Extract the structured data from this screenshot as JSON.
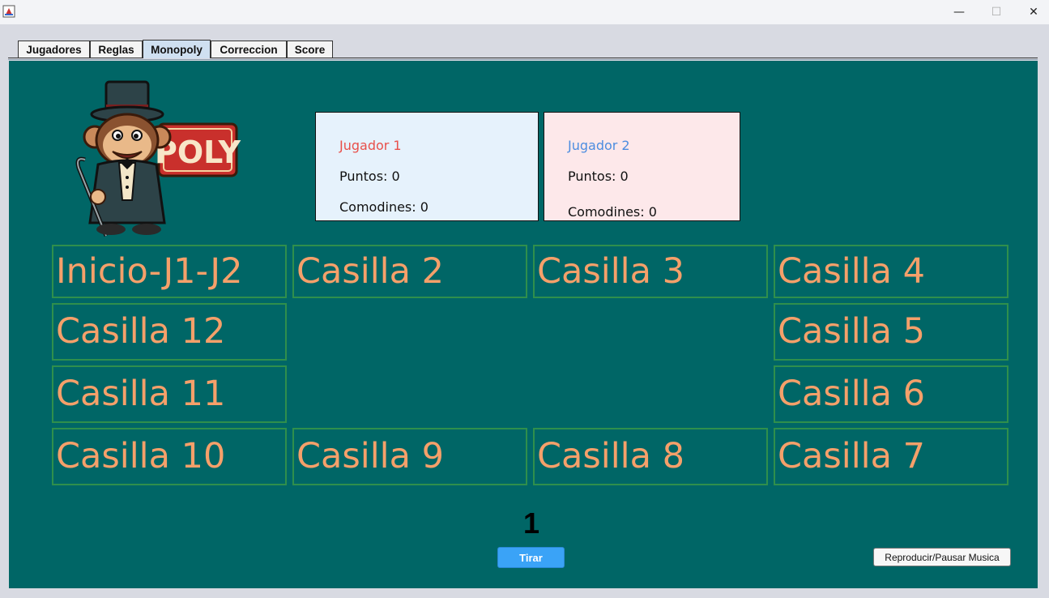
{
  "window": {
    "minimize_glyph": "—",
    "maximize_glyph": "☐",
    "close_glyph": "✕"
  },
  "tabs": [
    {
      "label": "Jugadores"
    },
    {
      "label": "Reglas"
    },
    {
      "label": "Monopoly",
      "active": true
    },
    {
      "label": "Correccion"
    },
    {
      "label": "Score"
    }
  ],
  "logo": {
    "text": "POLY"
  },
  "players": [
    {
      "name": "Jugador 1",
      "puntos": "Puntos: 0",
      "comodines": "Comodines: 0",
      "name_color": "#e8504a",
      "bg": "#e6f2fc"
    },
    {
      "name": "Jugador 2",
      "puntos": "Puntos: 0",
      "comodines": "Comodines: 0",
      "name_color": "#4d8de0",
      "bg": "#fde8ea"
    }
  ],
  "board": {
    "cells": [
      "Inicio-J1-J2",
      "Casilla 2",
      "Casilla 3",
      "Casilla 4",
      "Casilla 5",
      "Casilla 6",
      "Casilla 7",
      "Casilla 8",
      "Casilla 9",
      "Casilla 10",
      "Casilla 11",
      "Casilla 12"
    ],
    "text_color": "#f5a06a",
    "border_color": "#2f8f4c",
    "background": "#006666"
  },
  "dice": {
    "value": "1"
  },
  "buttons": {
    "tirar": "Tirar",
    "music": "Reproducir/Pausar Musica"
  }
}
